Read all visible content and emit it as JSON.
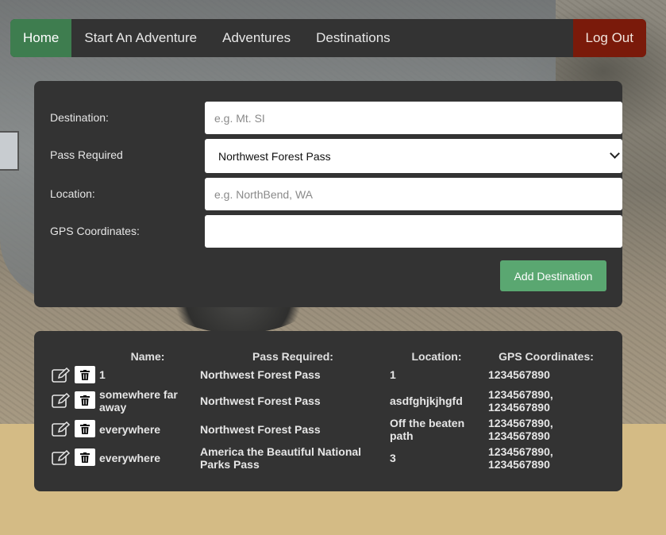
{
  "nav": {
    "items": [
      {
        "label": "Home"
      },
      {
        "label": "Start An Adventure"
      },
      {
        "label": "Adventures"
      },
      {
        "label": "Destinations"
      }
    ],
    "logout_label": "Log Out"
  },
  "form": {
    "destination_label": "Destination:",
    "destination_placeholder": "e.g. Mt. SI",
    "pass_label": "Pass Required",
    "pass_selected": "Northwest Forest Pass",
    "location_label": "Location:",
    "location_placeholder": "e.g. NorthBend, WA",
    "gps_label": "GPS Coordinates:",
    "gps_placeholder": "",
    "add_button": "Add Destination"
  },
  "table": {
    "headers": {
      "name": "Name:",
      "pass": "Pass Required:",
      "location": "Location:",
      "gps": "GPS Coordinates:"
    },
    "rows": [
      {
        "name": "1",
        "pass": "Northwest Forest Pass",
        "location": "1",
        "gps": "1234567890"
      },
      {
        "name": "somewhere far away",
        "pass": "Northwest Forest Pass",
        "location": "asdfghjkjhgfd",
        "gps": "1234567890, 1234567890"
      },
      {
        "name": "everywhere",
        "pass": "Northwest Forest Pass",
        "location": "Off the beaten path",
        "gps": "1234567890, 1234567890"
      },
      {
        "name": "everywhere",
        "pass": "America the Beautiful National Parks Pass",
        "location": "3",
        "gps": "1234567890, 1234567890"
      }
    ]
  },
  "colors": {
    "nav_bg": "#333333",
    "home_active": "#3e7d4f",
    "logout_bg": "#7a1a0a",
    "add_button_bg": "#5aa771",
    "page_bottom": "#d4bb85"
  }
}
